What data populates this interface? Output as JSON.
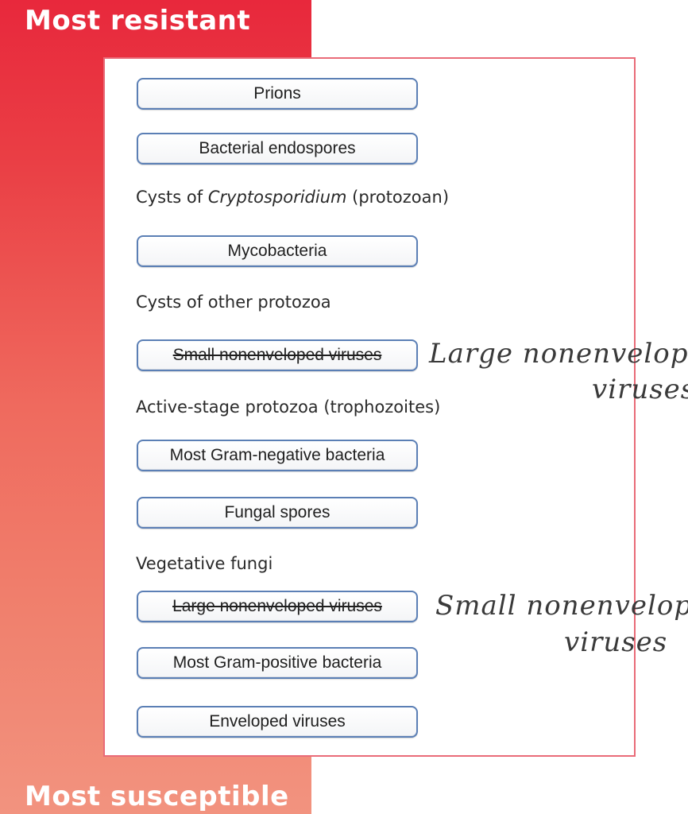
{
  "scale": {
    "top_label": "Most resistant",
    "bottom_label": "Most susceptible",
    "colors": {
      "top": "#e8283c",
      "bottom": "#f2937f",
      "panel_border": "#e96b78",
      "box_border": "#5b7fb5"
    }
  },
  "items": [
    {
      "label": "Prions",
      "style": "box"
    },
    {
      "label": "Bacterial endospores",
      "style": "box"
    },
    {
      "label_pre": "Cysts of ",
      "label_italic": "Cryptosporidium",
      "label_post": " (protozoan)",
      "style": "text"
    },
    {
      "label": "Mycobacteria",
      "style": "box"
    },
    {
      "label": "Cysts of other protozoa",
      "style": "text"
    },
    {
      "label": "Small nonenveloped viruses",
      "style": "box",
      "struck_through": true
    },
    {
      "label": "Active-stage protozoa (trophozoites)",
      "style": "text"
    },
    {
      "label": "Most Gram-negative bacteria",
      "style": "box"
    },
    {
      "label": "Fungal spores",
      "style": "box"
    },
    {
      "label": "Vegetative fungi",
      "style": "text"
    },
    {
      "label": "Large nonenveloped viruses",
      "style": "box",
      "struck_through": true
    },
    {
      "label": "Most Gram-positive bacteria",
      "style": "box"
    },
    {
      "label": "Enveloped viruses",
      "style": "box"
    }
  ],
  "annotations": [
    {
      "line1": "Large nonenveloped",
      "line2": "viruses",
      "corrects_item": "Small nonenveloped viruses"
    },
    {
      "line1": "Small nonenvelop",
      "line2": "viruses",
      "corrects_item": "Large nonenveloped viruses"
    }
  ]
}
